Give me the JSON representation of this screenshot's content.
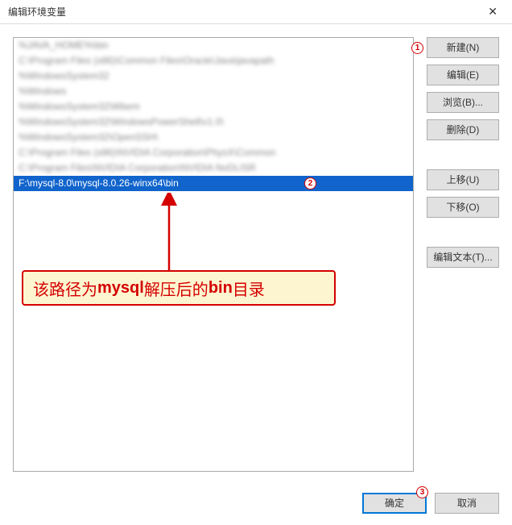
{
  "title": "编辑环境变量",
  "close_glyph": "✕",
  "list": {
    "blurred_rows": [
      "%JAVA_HOME%\\bin",
      "C:\\Program Files (x86)\\Common Files\\Oracle\\Java\\javapath",
      "%WindowsSystem32",
      "%Windows",
      "%WindowsSystem32\\Wbem",
      "%WindowsSystem32\\WindowsPowerShell\\v1.0\\",
      "%WindowsSystem32\\OpenSSH\\",
      "C:\\Program Files (x86)\\NVIDIA Corporation\\PhysX\\Common",
      "C:\\Program Files\\NVIDIA Corporation\\NVIDIA NvDLISR"
    ],
    "selected_row": "F:\\mysql-8.0\\mysql-8.0.26-winx64\\bin"
  },
  "buttons": {
    "new": "新建(N)",
    "edit": "编辑(E)",
    "browse": "浏览(B)...",
    "delete": "删除(D)",
    "moveup": "上移(U)",
    "movedown": "下移(O)",
    "edittext": "编辑文本(T)..."
  },
  "footer": {
    "ok": "确定",
    "cancel": "取消"
  },
  "badges": {
    "b1": "1",
    "b2": "2",
    "b3": "3"
  },
  "callout": {
    "prefix": "该路径为",
    "mid1": "mysql",
    "mid2": "解压后的",
    "mid3": "bin",
    "suffix": "目录"
  }
}
